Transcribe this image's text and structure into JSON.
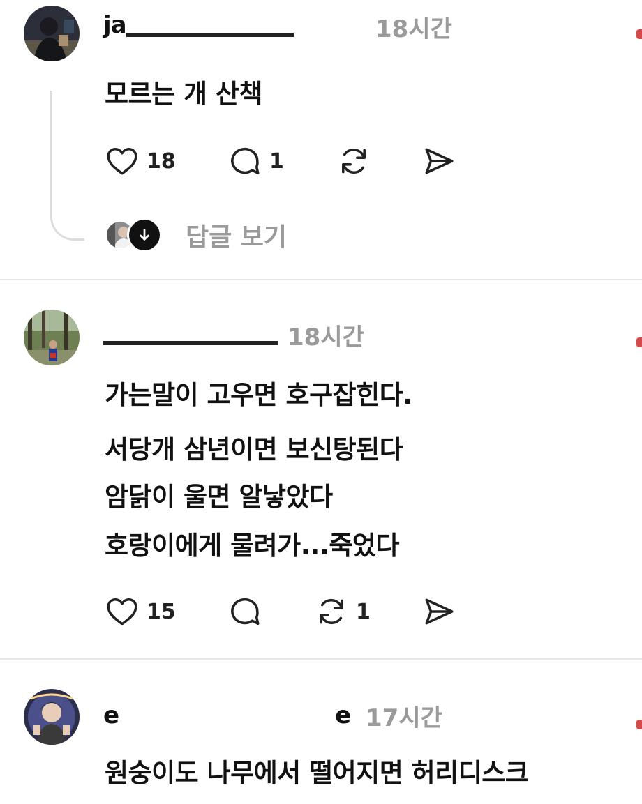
{
  "posts": [
    {
      "username_visible_start": "ja",
      "username_visible_end": "",
      "time": "18시간",
      "lines": [
        "모르는 개 산책"
      ],
      "actions": {
        "like_count": "18",
        "comment_count": "1",
        "repost_count": "",
        "share_count": ""
      },
      "replies_label": "답글 보기"
    },
    {
      "username_visible_start": "",
      "username_visible_end": "",
      "time": "18시간",
      "lines": [
        "가는말이 고우면 호구잡힌다.",
        "서당개 삼년이면 보신탕된다",
        "암닭이 울면 알낳았다",
        "호랑이에게 물려가...죽었다"
      ],
      "actions": {
        "like_count": "15",
        "comment_count": "",
        "repost_count": "1",
        "share_count": ""
      }
    },
    {
      "username_visible_start": "e",
      "username_visible_end": "e",
      "time": "17시간",
      "lines": [
        "원숭이도 나무에서 떨어지면 허리디스크"
      ]
    }
  ],
  "icons": {
    "like": "heart-icon",
    "comment": "comment-bubble-icon",
    "repost": "repost-icon",
    "share": "send-icon",
    "replies": "arrow-down-icon"
  },
  "colors": {
    "text": "#111111",
    "muted": "#9a9a9a",
    "divider": "#e8e8e8",
    "accent_dot": "#d44a4a"
  }
}
